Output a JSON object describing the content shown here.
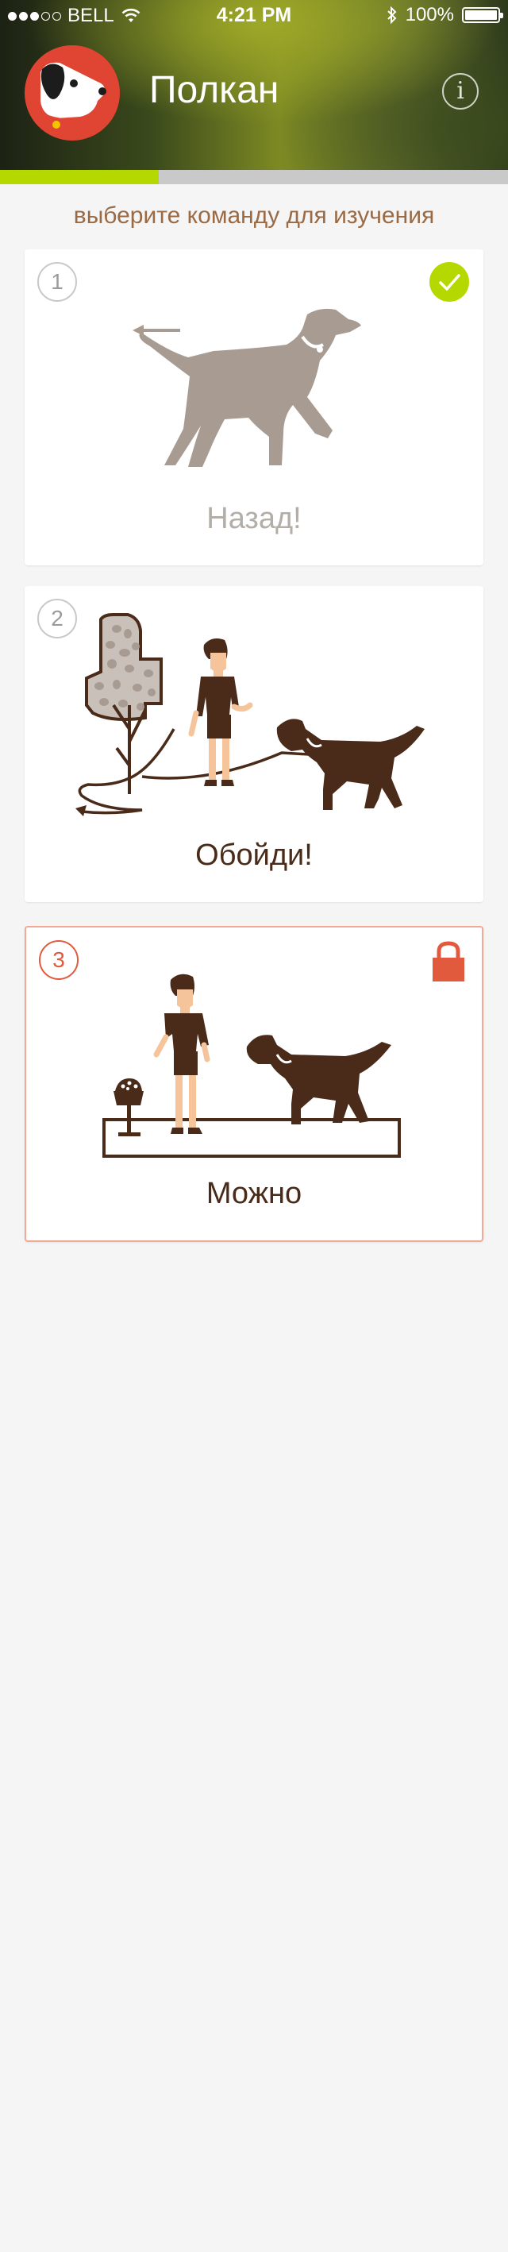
{
  "status_bar": {
    "carrier": "BELL",
    "time": "4:21 PM",
    "battery": "100%",
    "battery_level": 1.0,
    "signal_bars_filled": 3,
    "signal_bars_total": 5
  },
  "header": {
    "title": "Полкан",
    "info_label": "i",
    "accent_color": "#e04534"
  },
  "progress": {
    "fraction": 0.313,
    "fill_color": "#b5d900"
  },
  "subtitle": "выберите команду для изучения",
  "commands": [
    {
      "number": "1",
      "label": "Назад!",
      "state": "completed"
    },
    {
      "number": "2",
      "label": "Обойди!",
      "state": "available"
    },
    {
      "number": "3",
      "label": "Можно",
      "state": "locked"
    }
  ],
  "colors": {
    "completed_check": "#b5d900",
    "locked": "#e25a3e",
    "art_brown": "#4a2b1a",
    "art_grey": "#a89b92"
  }
}
